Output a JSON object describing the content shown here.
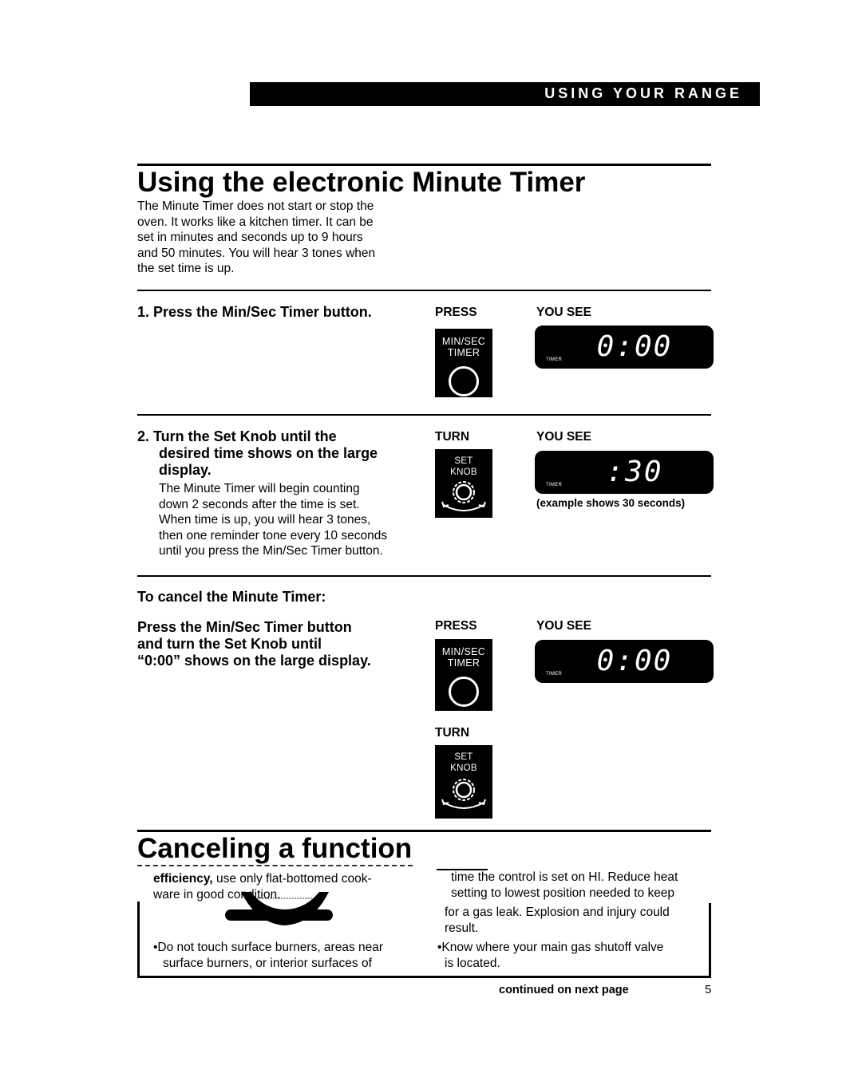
{
  "header": {
    "section_label": "USING YOUR RANGE"
  },
  "timer_section": {
    "title": "Using the electronic Minute Timer",
    "intro_lines": [
      "The Minute Timer does not start or stop the",
      "oven. It works like a kitchen timer. It can be",
      "set in minutes and seconds up to 9 hours",
      "and 50 minutes. You will hear 3 tones when",
      "the set time is up."
    ],
    "steps": [
      {
        "title": "1. Press the Min/Sec Timer button.",
        "action_label": "PRESS",
        "result_label": "YOU SEE",
        "control": {
          "icon": "min-sec-timer-button",
          "line1": "MIN/SEC",
          "line2": "TIMER"
        },
        "display": {
          "digits": "0:00",
          "tag": "TIMER"
        }
      },
      {
        "title_lines": [
          "2. Turn the Set Knob until the",
          "desired time shows on the large",
          "display."
        ],
        "body_lines": [
          "The Minute Timer will begin counting",
          "down 2 seconds after the time is set.",
          "When time is up, you will hear 3 tones,",
          "then one reminder tone every 10 seconds",
          "until you press the Min/Sec Timer button."
        ],
        "action_label": "TURN",
        "result_label": "YOU SEE",
        "control": {
          "icon": "set-knob",
          "line1": "SET",
          "line2": "KNOB"
        },
        "display": {
          "digits": ":30",
          "tag": "TIMER"
        },
        "caption": "(example shows 30 seconds)"
      }
    ],
    "cancel": {
      "heading": "To cancel the Minute Timer:",
      "instruction_lines": [
        "Press the Min/Sec Timer button",
        "and turn the Set Knob until",
        "“0:00” shows on the large display."
      ],
      "press_label": "PRESS",
      "result_label": "YOU SEE",
      "press_control": {
        "icon": "min-sec-timer-button",
        "line1": "MIN/SEC",
        "line2": "TIMER"
      },
      "display": {
        "digits": "0:00",
        "tag": "TIMER"
      },
      "turn_label": "TURN",
      "turn_control": {
        "icon": "set-knob",
        "line1": "SET",
        "line2": "KNOB"
      }
    }
  },
  "cancel_section": {
    "title": "Canceling a function",
    "left_column": {
      "efficiency_bold": "efficiency,",
      "efficiency_rest": " use only flat-bottomed cook-",
      "line2": "ware in good condition.",
      "bullet_lines": [
        "•Do not touch surface burners, areas near",
        "surface burners, or interior surfaces of"
      ]
    },
    "right_column": {
      "line1": "time the control is set on HI. Reduce heat",
      "line2": "setting to lowest position needed to keep",
      "line3": "for a gas leak. Explosion and injury could",
      "line4": "result.",
      "bullet_lines": [
        "•Know where your main gas shutoff valve",
        "is located."
      ]
    }
  },
  "footer": {
    "continued": "continued on next page",
    "page_number": "5"
  }
}
